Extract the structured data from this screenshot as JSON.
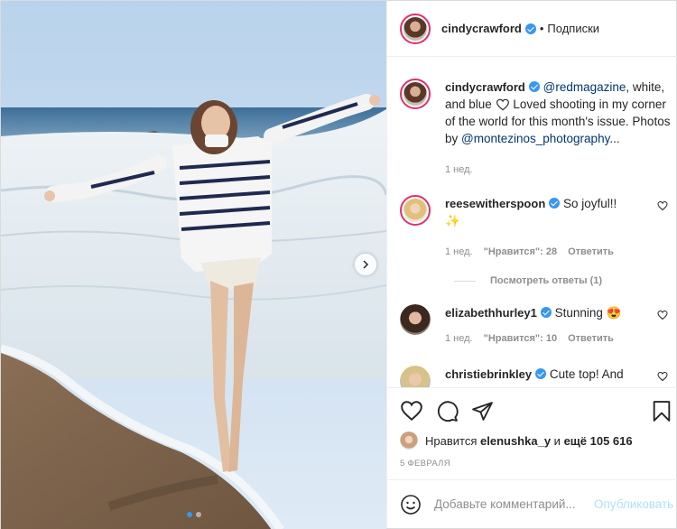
{
  "header": {
    "username": "cindycrawford",
    "separator": "•",
    "follow_label": "Подписки"
  },
  "caption": {
    "username": "cindycrawford",
    "mention": "@redmagazine",
    "text_a": ", white, and blue",
    "text_b": " Loved shooting in my corner of the world for this month's issue. Photos by ",
    "mention2": "@montezinos_photography",
    "ellipsis": "...",
    "time": "1 нед."
  },
  "comments": [
    {
      "username": "reesewitherspoon",
      "text": "So joyful!!",
      "emoji": "✨",
      "time": "1 нед.",
      "likes": "\"Нравится\": 28",
      "reply": "Ответить",
      "view_replies": "Посмотреть ответы (1)"
    },
    {
      "username": "elizabethhurley1",
      "text": "Stunning",
      "emoji": "😍",
      "time": "1 нед.",
      "likes": "\"Нравится\": 10",
      "reply": "Ответить"
    },
    {
      "username": "christiebrinkley",
      "text": "Cute top! And"
    }
  ],
  "likes_line": {
    "prefix": "Нравится",
    "user": "elenushka_y",
    "middle": "и",
    "count": "ещё 105 616"
  },
  "date": "5 февраля",
  "add_comment": {
    "placeholder": "Добавьте комментарий...",
    "publish": "Опубликовать"
  },
  "colors": {
    "accent": "#3897f0",
    "link": "#00376b",
    "muted": "#8e8e8e",
    "publish_disabled": "#b2dffc"
  },
  "icons": [
    "chevron-right-icon",
    "heart-icon",
    "comment-icon",
    "share-icon",
    "bookmark-icon",
    "emoji-icon",
    "verified-badge-icon"
  ]
}
